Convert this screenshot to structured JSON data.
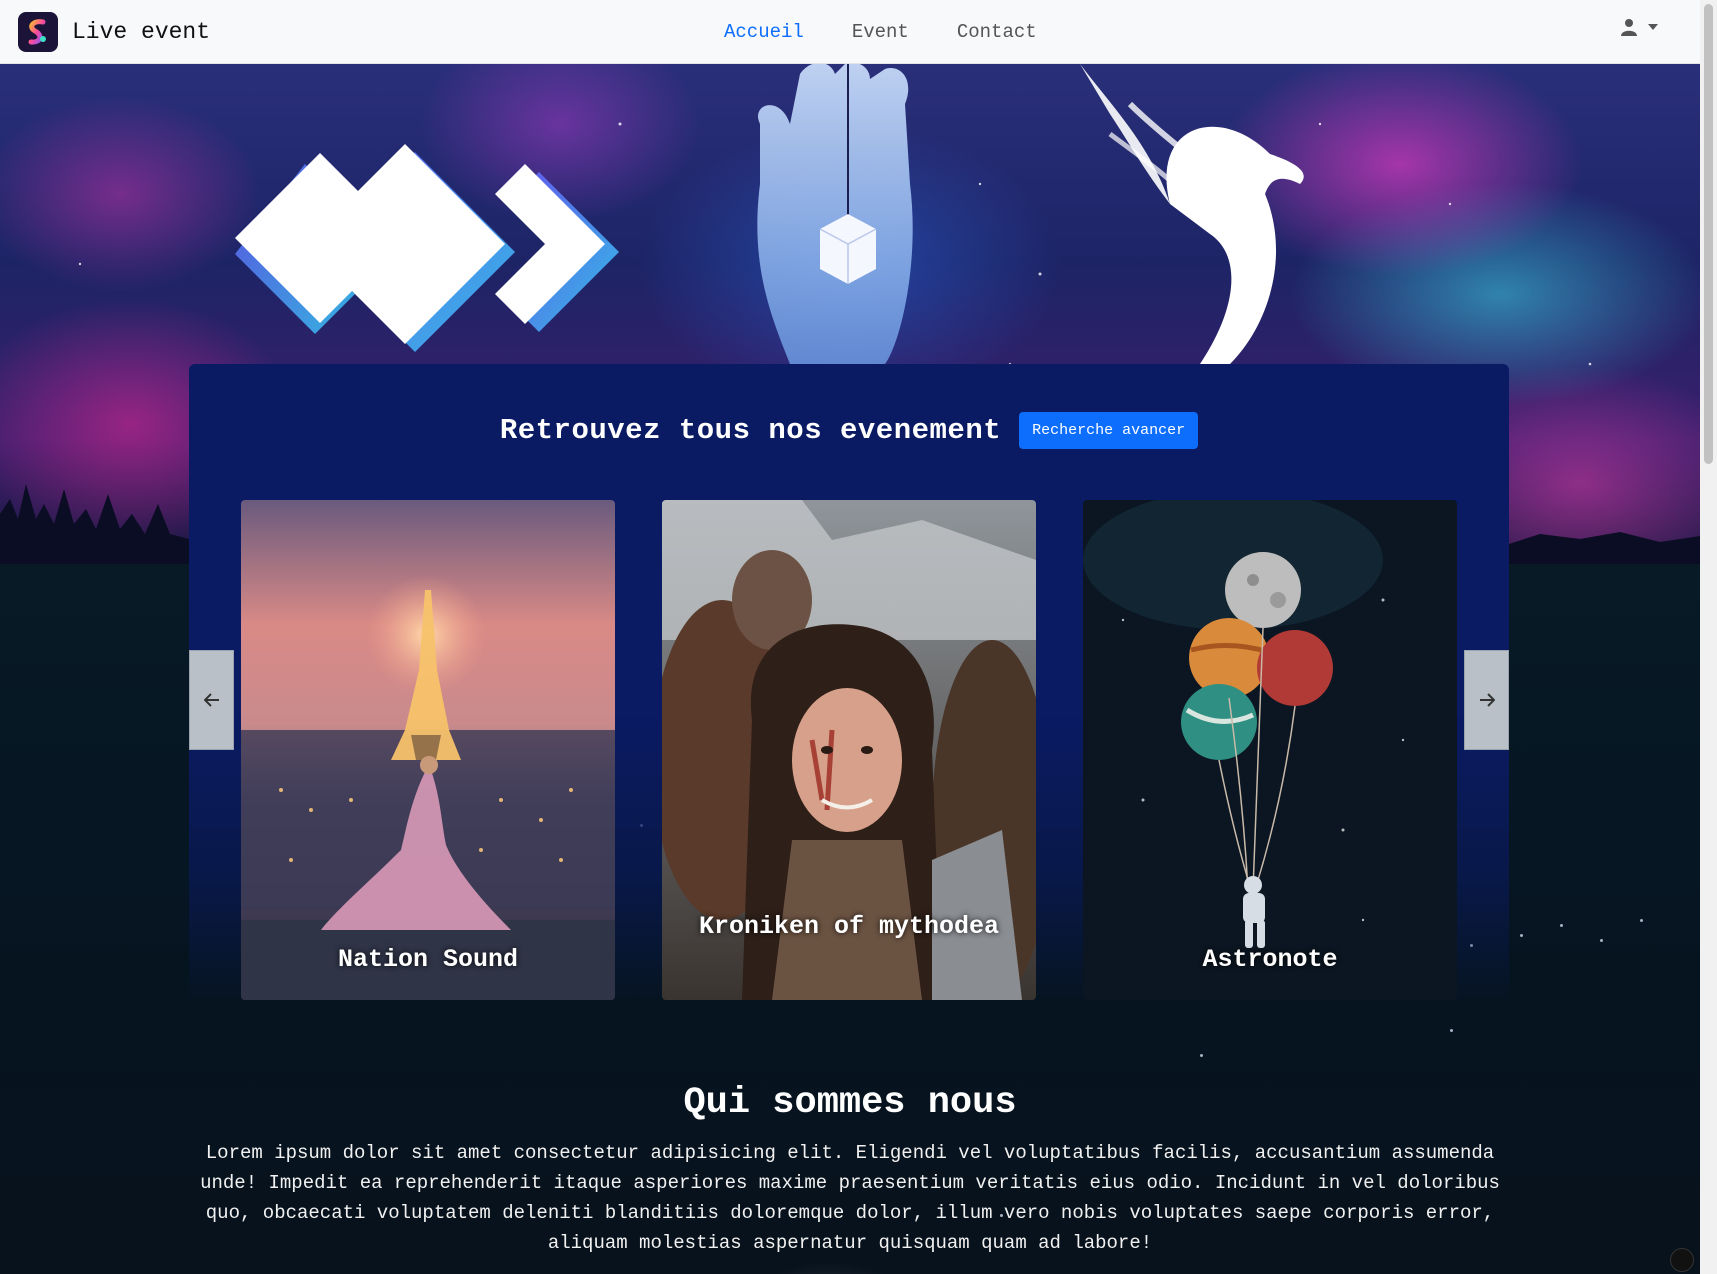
{
  "nav": {
    "brand": "Live event",
    "links": [
      {
        "label": "Accueil",
        "active": true
      },
      {
        "label": "Event",
        "active": false
      },
      {
        "label": "Contact",
        "active": false
      }
    ],
    "active_color": "#0d6efd"
  },
  "icons": {
    "brand_logo": "swirl-logo-icon",
    "user": "user-icon",
    "caret": "caret-down-icon",
    "prev": "arrow-left-icon",
    "next": "arrow-right-icon"
  },
  "events": {
    "title": "Retrouvez tous nos evenement",
    "search_button": "Recherche avancer",
    "cards": [
      {
        "label": "Nation Sound"
      },
      {
        "label": "Kroniken of mythodea"
      },
      {
        "label": "Astronote"
      }
    ]
  },
  "about": {
    "title": "Qui sommes nous",
    "text": "Lorem ipsum dolor sit amet consectetur adipisicing elit. Eligendi vel voluptatibus facilis, accusantium assumenda unde! Impedit ea reprehenderit itaque asperiores maxime praesentium veritatis eius odio. Incidunt in vel doloribus quo, obcaecati voluptatem deleniti blanditiis doloremque dolor, illum vero nobis voluptates saepe corporis error, aliquam molestias aspernatur quisquam quam ad labore!"
  },
  "colors": {
    "panel": "#0a1a63",
    "button": "#0d6efd",
    "background": "#061420"
  }
}
